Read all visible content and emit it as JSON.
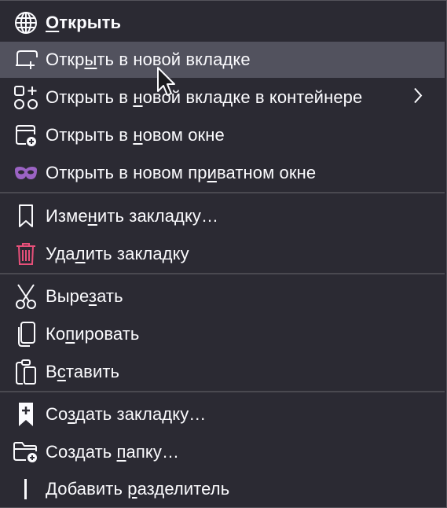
{
  "menu": {
    "items": [
      {
        "icon": "globe-icon",
        "parts": [
          "",
          "О",
          "ткрыть"
        ],
        "bold": true
      },
      {
        "icon": "new-tab-icon",
        "parts": [
          "Откр",
          "ы",
          "ть в новой вкладке"
        ]
      },
      {
        "icon": "container-icon",
        "parts": [
          "Открыть в ",
          "н",
          "овой вкладке в контейнере"
        ],
        "submenu": true
      },
      {
        "icon": "new-window-icon",
        "parts": [
          "Открыть в ",
          "н",
          "овом окне"
        ]
      },
      {
        "icon": "private-mask-icon",
        "parts": [
          "Открыть в новом пр",
          "и",
          "ватном окне"
        ]
      },
      {
        "icon": "bookmark-icon",
        "parts": [
          "Изме",
          "н",
          "ить закладку…"
        ]
      },
      {
        "icon": "trash-icon",
        "parts": [
          "Уда",
          "л",
          "ить закладку"
        ]
      },
      {
        "icon": "scissors-icon",
        "parts": [
          "Выре",
          "з",
          "ать"
        ]
      },
      {
        "icon": "copy-icon",
        "parts": [
          "Ко",
          "п",
          "ировать"
        ]
      },
      {
        "icon": "clipboard-icon",
        "parts": [
          "В",
          "с",
          "тавить"
        ]
      },
      {
        "icon": "add-bookmark-icon",
        "parts": [
          "Со",
          "з",
          "дать закладку…"
        ]
      },
      {
        "icon": "new-folder-icon",
        "parts": [
          "Создать ",
          "п",
          "апку…"
        ]
      },
      {
        "icon": "separator-icon",
        "parts": [
          "Добавить ",
          "р",
          "азделитель"
        ]
      }
    ],
    "colors": {
      "background": "#2b2a33",
      "hover": "#52525e",
      "text": "#fbfbfe",
      "mask": "#9b63c4",
      "trash": "#e8507a"
    }
  }
}
